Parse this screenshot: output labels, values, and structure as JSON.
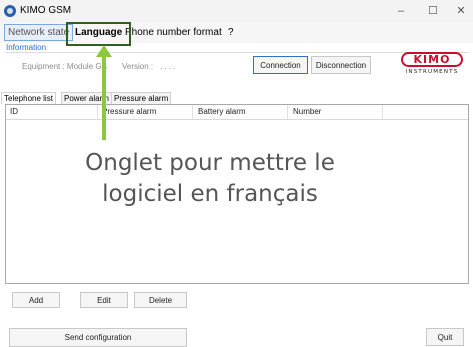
{
  "window": {
    "title": "KIMO GSM",
    "controls": [
      "–",
      "☐",
      "✕"
    ]
  },
  "menu": {
    "items": [
      "Network state",
      "Language",
      "Phone number format",
      "?"
    ]
  },
  "information": {
    "group_label": "Information",
    "equipment": "Equipment : Module GS",
    "version": "Version :",
    "version_value": ". . . .",
    "connection_button": "Connection",
    "disconnection_button": "Disconnection"
  },
  "logo": {
    "name": "KIMO",
    "subtitle": "INSTRUMENTS",
    "color": "#c8102e"
  },
  "tabs": [
    "Telephone list",
    "Power alarm",
    "Pressure alarm"
  ],
  "table": {
    "columns": [
      "ID",
      "Pressure alarm",
      "Battery alarm",
      "Number"
    ],
    "rows": []
  },
  "actions": {
    "add": "Add",
    "edit": "Edit",
    "delete": "Delete",
    "send_configuration": "Send configuration",
    "quit": "Quit"
  },
  "annotation": {
    "line1": "Onglet pour mettre le",
    "line2": "logiciel en français",
    "highlight_color": "#2f5e1e",
    "arrow_color": "#8dc63f"
  }
}
